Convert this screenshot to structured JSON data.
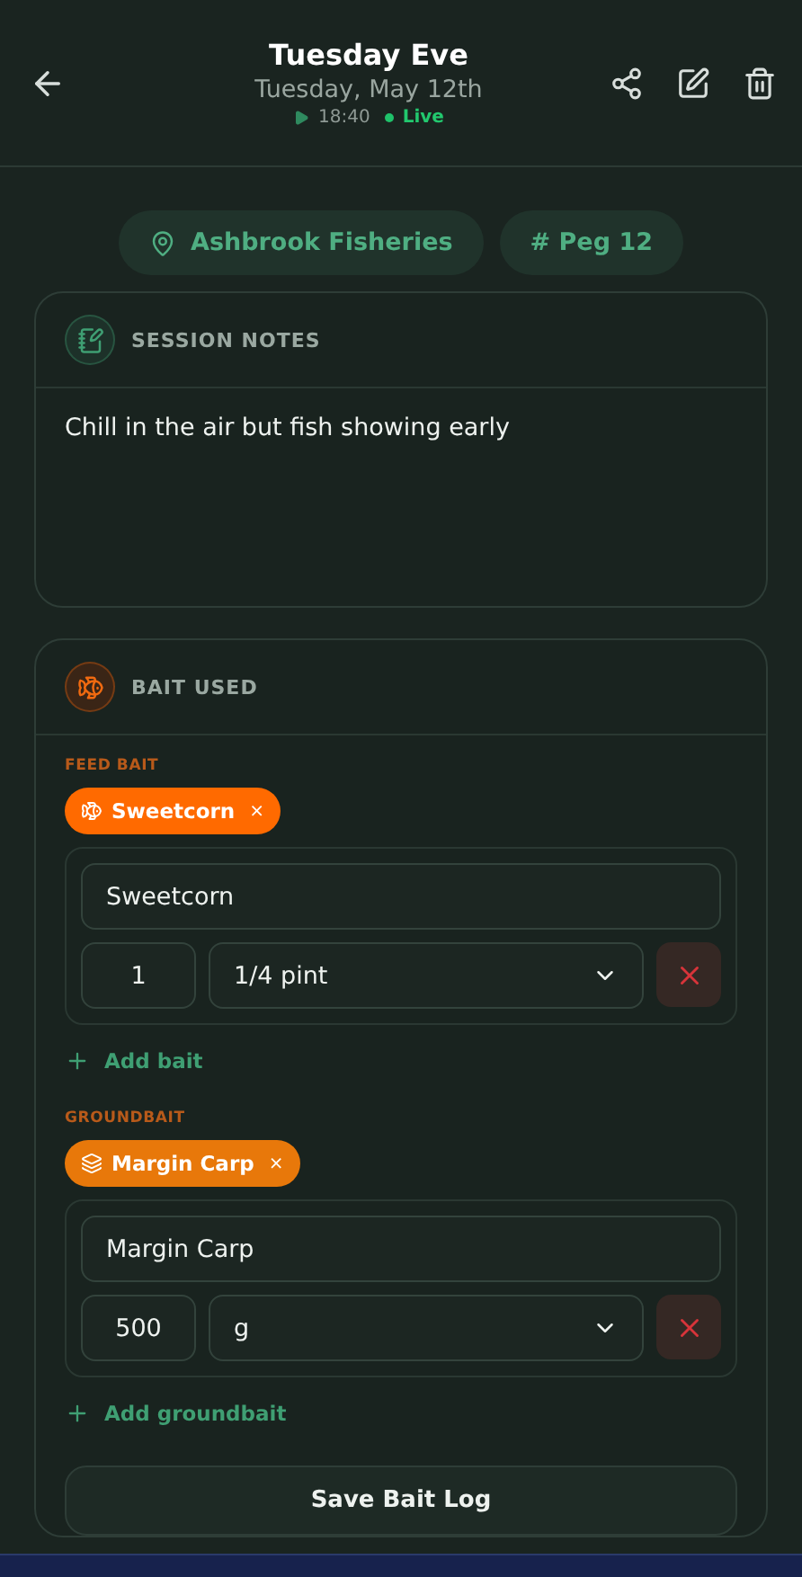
{
  "header": {
    "title": "Tuesday Eve",
    "date": "Tuesday, May 12th",
    "time": "18:40",
    "status": "Live"
  },
  "chips": [
    {
      "kind": "location",
      "label": "Ashbrook Fisheries"
    },
    {
      "kind": "peg",
      "label": "# Peg 12"
    }
  ],
  "notes": {
    "title": "SESSION NOTES",
    "text": "Chill in the air but fish showing early"
  },
  "bait": {
    "title": "BAIT USED",
    "sections": [
      {
        "kind": "feed",
        "label": "FEED BAIT",
        "chip": "Sweetcorn",
        "chip_close": "×",
        "color": "#ff6a00",
        "entries": [
          {
            "name": "Sweetcorn",
            "qty": "1",
            "unit": "1/4 pint"
          }
        ],
        "add": "Add bait"
      },
      {
        "kind": "ground",
        "label": "GROUNDBAIT",
        "chip": "Margin Carp",
        "chip_close": "×",
        "color": "#e8780a",
        "entries": [
          {
            "name": "Margin Carp",
            "qty": "500",
            "unit": "g"
          }
        ],
        "add": "Add groundbait"
      }
    ],
    "save": "Save Bait Log"
  }
}
